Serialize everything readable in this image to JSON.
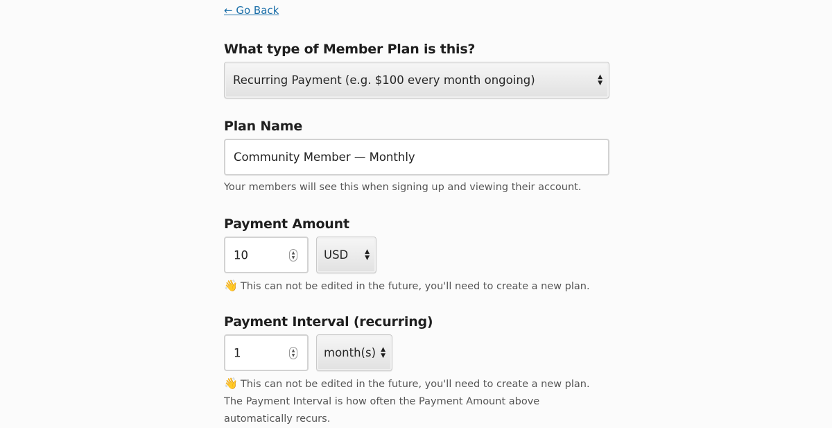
{
  "back_link": "← Go Back",
  "plan_type": {
    "label": "What type of Member Plan is this?",
    "selected": "Recurring Payment (e.g. $100 every month ongoing)"
  },
  "plan_name": {
    "label": "Plan Name",
    "value": "Community Member — Monthly",
    "help": "Your members will see this when signing up and viewing their account."
  },
  "payment_amount": {
    "label": "Payment Amount",
    "value": "10",
    "currency": "USD",
    "help_icon": "👋",
    "help": "This can not be edited in the future, you'll need to create a new plan."
  },
  "payment_interval": {
    "label": "Payment Interval (recurring)",
    "value": "1",
    "unit": "month(s)",
    "help_icon": "👋",
    "help": "This can not be edited in the future, you'll need to create a new plan. The Payment Interval is how often the Payment Amount above automatically recurs."
  },
  "icons": {
    "select_arrows": "updown-arrows-icon",
    "spinner": "number-spinner-icon",
    "wave": "waving-hand-icon"
  }
}
